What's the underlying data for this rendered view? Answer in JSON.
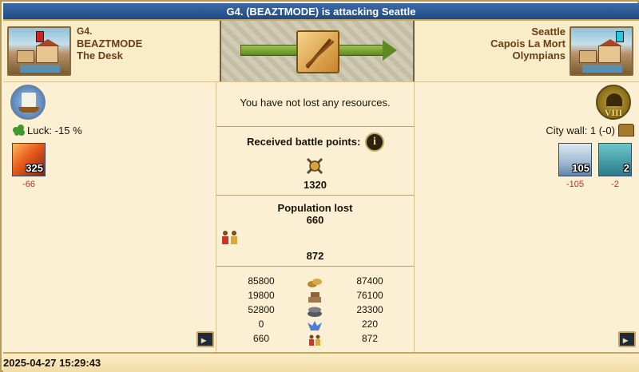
{
  "title": "G4. (BEAZTMODE) is attacking Seattle",
  "attacker": {
    "alliance": "G4.",
    "player": "BEAZTMODE",
    "city": "The Desk",
    "luck": "Luck: -15 %",
    "flag_color": "#d42020",
    "units": [
      {
        "icon": "fire-ship-icon",
        "count": "325",
        "loss": "-66"
      }
    ]
  },
  "defender": {
    "city": "Seattle",
    "player": "Capois La Mort",
    "alliance": "Olympians",
    "city_wall": "City wall: 1 (-0)",
    "wall_level": "VIII",
    "flag_color": "#28c8d8",
    "units": [
      {
        "icon": "trireme-icon",
        "count": "105",
        "loss": "-105"
      },
      {
        "icon": "siren-icon",
        "count": "2",
        "loss": "-2"
      }
    ]
  },
  "result": {
    "resources_text": "You have not lost any resources.",
    "battle_points_label": "Received battle points:",
    "battle_points": "1320",
    "population_label": "Population lost",
    "population_attacker": "660",
    "population_defender": "872"
  },
  "comparison": [
    {
      "icon": "wood-icon",
      "attacker": "85800",
      "defender": "87400"
    },
    {
      "icon": "stone-icon",
      "attacker": "19800",
      "defender": "76100"
    },
    {
      "icon": "silver-icon",
      "attacker": "52800",
      "defender": "23300"
    },
    {
      "icon": "favor-icon",
      "attacker": "0",
      "defender": "220"
    },
    {
      "icon": "population-icon",
      "attacker": "660",
      "defender": "872"
    }
  ],
  "timestamp": "2025-04-27 15:29:43"
}
